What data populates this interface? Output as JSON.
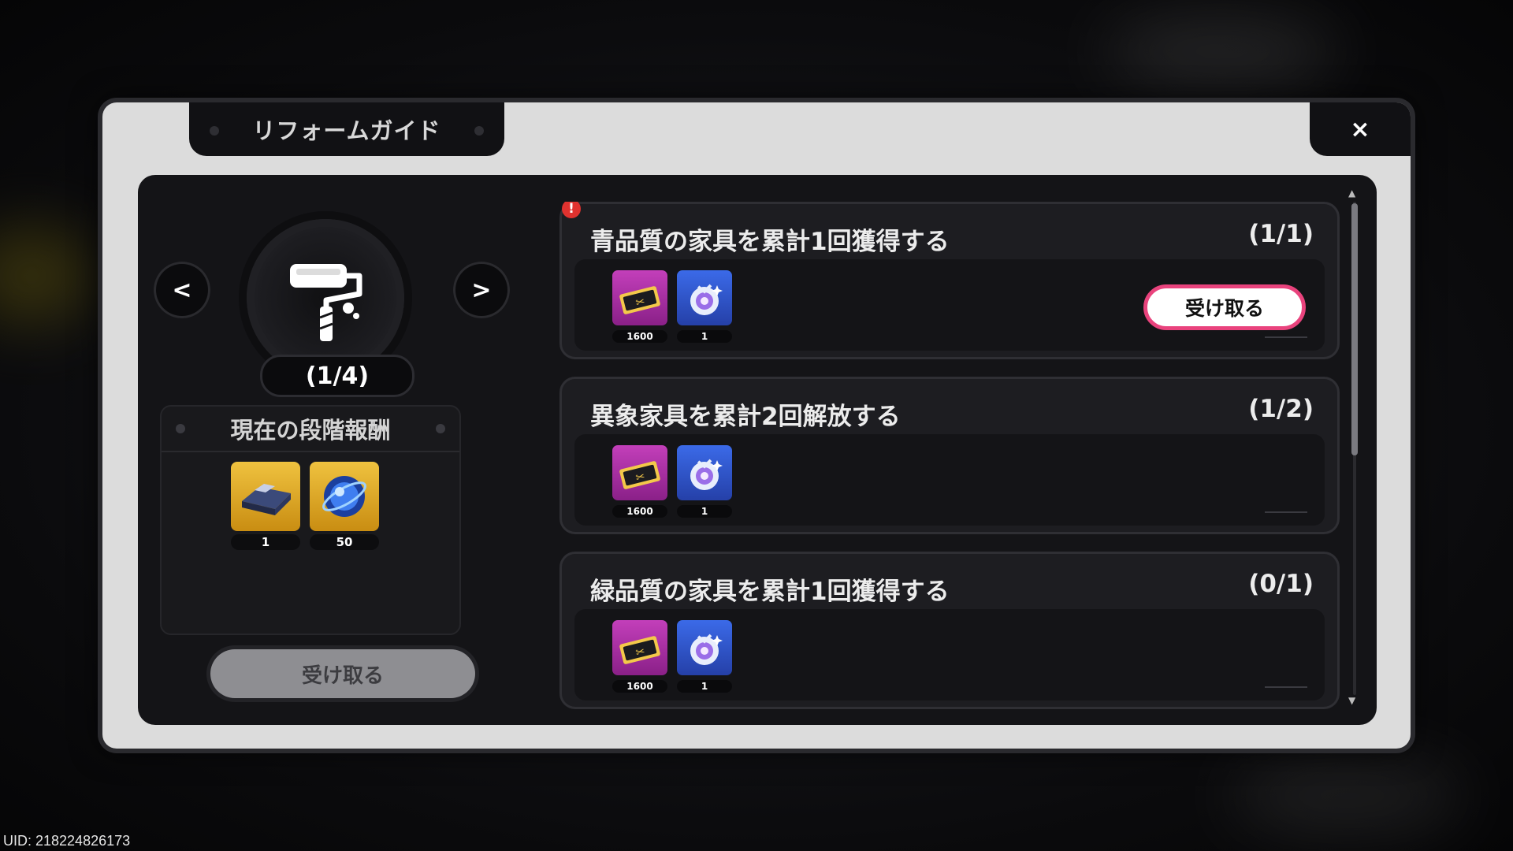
{
  "window": {
    "title": "リフォームガイド",
    "close_label": "×"
  },
  "stage": {
    "progress_label": "(1/4)",
    "prev_label": "<",
    "next_label": ">"
  },
  "current_reward": {
    "title": "現在の段階報酬",
    "items": [
      {
        "icon": "bed-furniture-icon",
        "count": "1"
      },
      {
        "icon": "blue-orb-icon",
        "count": "50"
      }
    ],
    "claim_label": "受け取る"
  },
  "quests": [
    {
      "title": "青品質の家具を累計1回獲得する",
      "progress": "(1/1)",
      "alert": "!",
      "rewards": [
        {
          "icon": "ticket-icon",
          "count": "1600"
        },
        {
          "icon": "gem-bag-icon",
          "count": "1"
        }
      ],
      "claim_label": "受け取る"
    },
    {
      "title": "異象家具を累計2回解放する",
      "progress": "(1/2)",
      "rewards": [
        {
          "icon": "ticket-icon",
          "count": "1600"
        },
        {
          "icon": "gem-bag-icon",
          "count": "1"
        }
      ]
    },
    {
      "title": "緑品質の家具を累計1回獲得する",
      "progress": "(0/1)",
      "rewards": [
        {
          "icon": "ticket-icon",
          "count": "1600"
        },
        {
          "icon": "gem-bag-icon",
          "count": "1"
        }
      ]
    }
  ],
  "footer": {
    "uid": "UID: 218224826173"
  },
  "colors": {
    "accent_pink": "#e9437d",
    "reward_gold": "#efc23f",
    "reward_purple": "#c33fba",
    "reward_blue": "#3b6ae8",
    "alert_red": "#e0322f"
  }
}
